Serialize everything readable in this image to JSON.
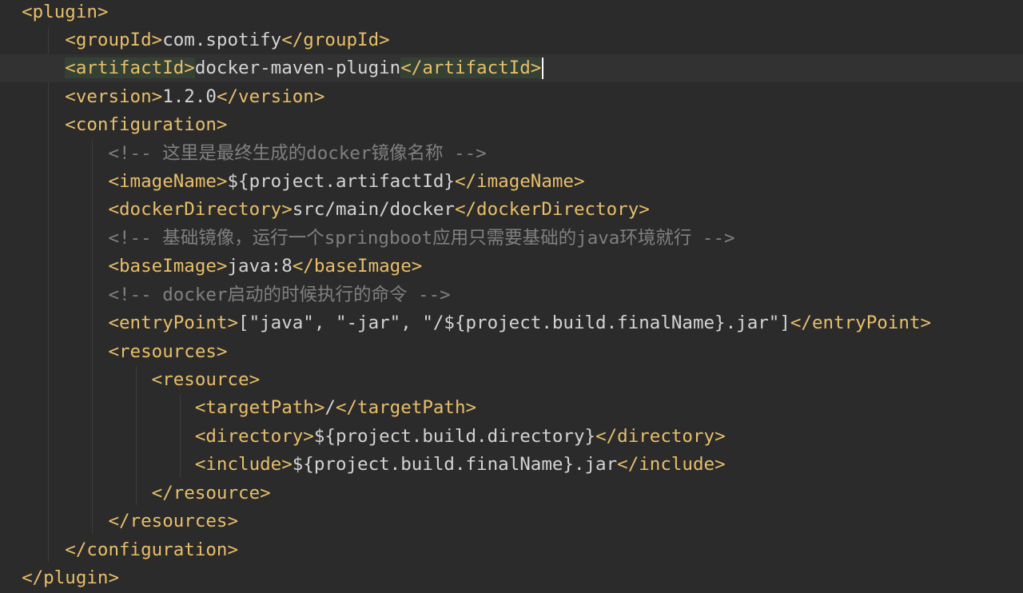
{
  "colors": {
    "background": "#2b2b2b",
    "current_line": "#323232",
    "tag": "#e8bf6a",
    "text": "#d4d4d4",
    "comment": "#808080",
    "tag_match_highlight": "#344134",
    "caret": "#ffffff"
  },
  "code": {
    "plugin_open": "<plugin>",
    "groupid": {
      "open": "<groupId>",
      "value": "com.spotify",
      "close": "</groupId>"
    },
    "artifactid": {
      "open": "<artifactId>",
      "value": "docker-maven-plugin",
      "close": "</artifactId>"
    },
    "version": {
      "open": "<version>",
      "value": "1.2.0",
      "close": "</version>"
    },
    "configuration_open": "<configuration>",
    "comment_imagename": "<!-- 这里是最终生成的docker镜像名称 -->",
    "imagename": {
      "open": "<imageName>",
      "value": "${project.artifactId}",
      "close": "</imageName>"
    },
    "dockerdirectory": {
      "open": "<dockerDirectory>",
      "value": "src/main/docker",
      "close": "</dockerDirectory>"
    },
    "comment_baseimage": "<!-- 基础镜像，运行一个springboot应用只需要基础的java环境就行 -->",
    "baseimage": {
      "open": "<baseImage>",
      "value": "java:8",
      "close": "</baseImage>"
    },
    "comment_entrypoint": "<!-- docker启动的时候执行的命令 -->",
    "entrypoint": {
      "open": "<entryPoint>",
      "value": "[\"java\", \"-jar\", \"/${project.build.finalName}.jar\"]",
      "close": "</entryPoint>"
    },
    "resources_open": "<resources>",
    "resource_open": "<resource>",
    "targetpath": {
      "open": "<targetPath>",
      "value": "/",
      "close": "</targetPath>"
    },
    "directory": {
      "open": "<directory>",
      "value": "${project.build.directory}",
      "close": "</directory>"
    },
    "include": {
      "open": "<include>",
      "value": "${project.build.finalName}.jar",
      "close": "</include>"
    },
    "resource_close": "</resource>",
    "resources_close": "</resources>",
    "configuration_close": "</configuration>",
    "plugin_close": "</plugin>"
  }
}
